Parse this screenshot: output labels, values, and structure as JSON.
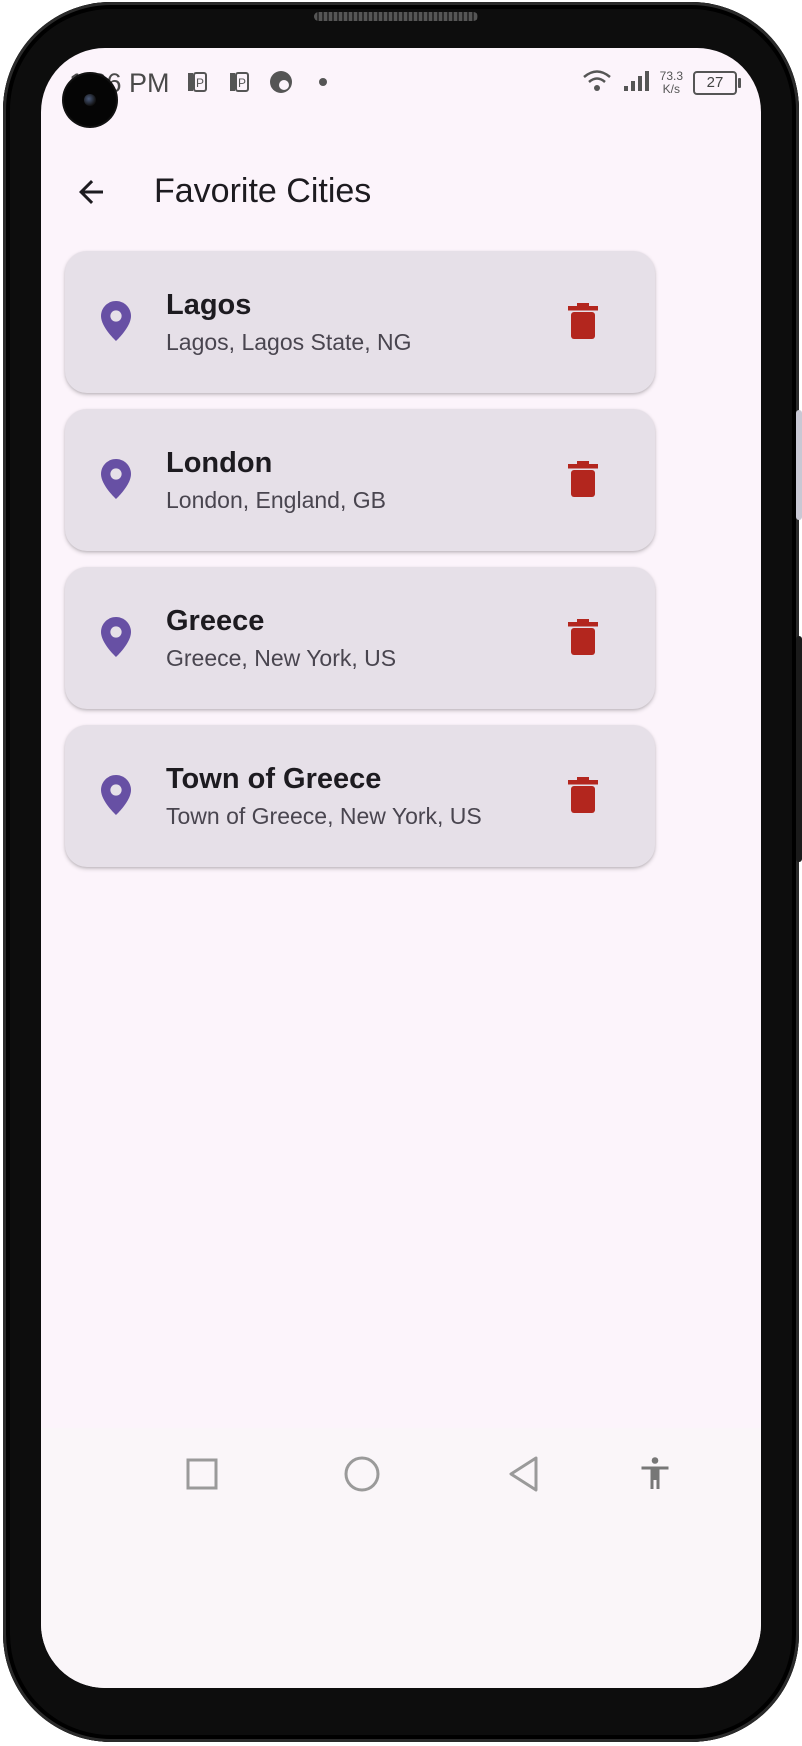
{
  "status_bar": {
    "time": "1:36 PM",
    "left_icons": [
      "notification-p-icon",
      "notification-p-icon",
      "vpn-globe-icon",
      "dot-icon"
    ],
    "net_speed_value": "73.3",
    "net_speed_unit": "K/s",
    "battery": "27"
  },
  "app_bar": {
    "title": "Favorite Cities"
  },
  "cities": [
    {
      "name": "Lagos",
      "detail": "Lagos, Lagos State, NG"
    },
    {
      "name": "London",
      "detail": "London, England, GB"
    },
    {
      "name": "Greece",
      "detail": "Greece, New York, US"
    },
    {
      "name": "Town of Greece",
      "detail": "Town of Greece, New York, US"
    }
  ],
  "colors": {
    "background": "#fcf4fb",
    "card": "#e6e0e8",
    "pin": "#6750a4",
    "delete": "#b3261e",
    "text": "#1d1b20"
  }
}
